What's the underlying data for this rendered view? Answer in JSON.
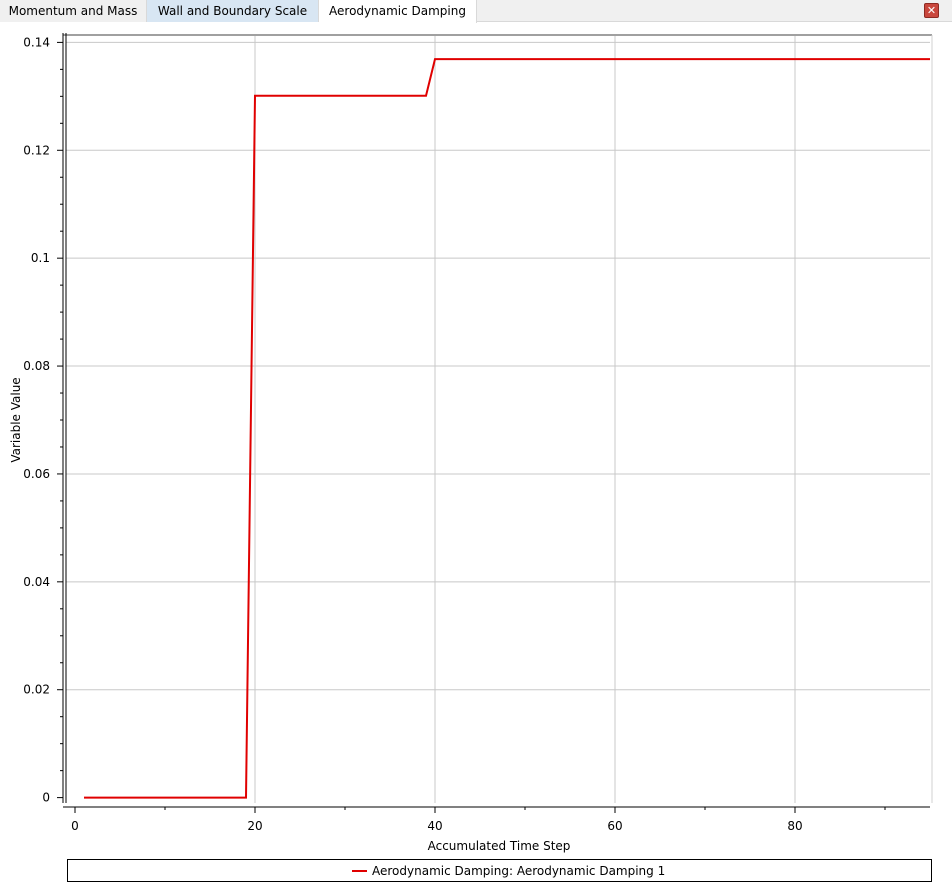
{
  "tabs": [
    {
      "label": "Momentum and Mass"
    },
    {
      "label": "Wall and Boundary Scale"
    },
    {
      "label": "Aerodynamic Damping"
    }
  ],
  "close_icon": "close-icon",
  "chart_data": {
    "type": "line",
    "xlabel": "Accumulated Time Step",
    "ylabel": "Variable Value",
    "xlim": [
      -1,
      95
    ],
    "ylim": [
      -0.001,
      0.141
    ],
    "x_ticks": [
      0,
      20,
      40,
      60,
      80
    ],
    "y_ticks": [
      0,
      0.02,
      0.04,
      0.06,
      0.08,
      0.1,
      0.12,
      0.14
    ],
    "grid": true,
    "legend_position": "bottom",
    "series": [
      {
        "name": "Aerodynamic Damping: Aerodynamic Damping 1",
        "color": "#e00000",
        "x": [
          1,
          19,
          20,
          39,
          40,
          95
        ],
        "y": [
          0,
          0,
          0.1301,
          0.1301,
          0.1369,
          0.1369
        ]
      }
    ]
  }
}
